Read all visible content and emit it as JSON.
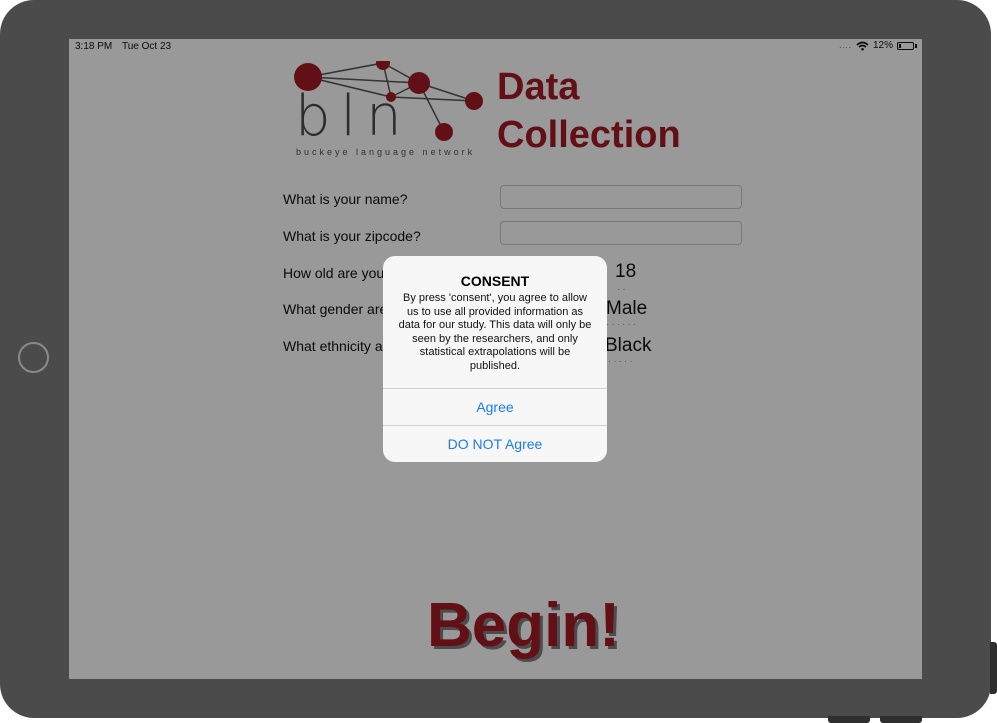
{
  "status_bar": {
    "time": "3:18 PM",
    "date": "Tue Oct 23",
    "signal": "....",
    "battery": "12%",
    "battery_level": 0.12
  },
  "logo": {
    "letters": "bln",
    "tagline": "buckeye language network"
  },
  "title": {
    "line1": "Data",
    "line2": "Collection"
  },
  "form": {
    "name_label": "What is your name?",
    "zipcode_label": "What is your zipcode?",
    "age_label": "How old are you",
    "gender_label": "What gender are",
    "ethnicity_label": "What ethnicity a",
    "age_value": "18",
    "gender_value": "Male",
    "ethnicity_value": "Black"
  },
  "begin_label": "Begin!",
  "alert": {
    "title": "CONSENT",
    "message": "By press 'consent', you agree to allow us to use all provided information as data for our study. This data will only be seen by the researchers, and only statistical extrapolations will be published.",
    "agree": "Agree",
    "disagree": "DO NOT Agree"
  },
  "colors": {
    "accent": "#a41c24",
    "link": "#1a7cf2",
    "device": "#4b4b4b"
  }
}
